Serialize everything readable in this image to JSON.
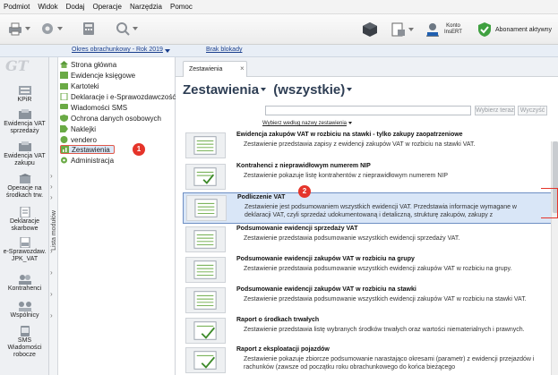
{
  "menubar": [
    "Podmiot",
    "Widok",
    "Dodaj",
    "Operacje",
    "Narzędzia",
    "Pomoc"
  ],
  "toolbar": {
    "buttons": [
      "printer-icon",
      "settings-icon",
      "calculator-icon",
      "search-icon"
    ],
    "right": [
      "cube-icon",
      "document-icon"
    ],
    "konto_label": "Konto",
    "konto_sub": "InsERT",
    "abonament_label": "Abonament aktywny"
  },
  "subbar": {
    "okres": "Okres obrachunkowy - Rok 2019",
    "brak": "Brak blokady"
  },
  "rail": {
    "logo": "GT",
    "items": [
      {
        "label": "KPiR",
        "icon": "kpir-icon"
      },
      {
        "label": "Ewidencja VAT sprzedaży",
        "icon": "vat-sales-icon"
      },
      {
        "label": "Ewidencja VAT zakupu",
        "icon": "vat-purchase-icon"
      },
      {
        "label": "Operacje na środkach trw.",
        "icon": "fixed-assets-icon"
      },
      {
        "label": "Deklaracje skarbowe",
        "icon": "tax-declarations-icon"
      },
      {
        "label": "e-Sprawozdaw. JPK_VAT",
        "icon": "jpk-icon"
      },
      {
        "label": "Kontrahenci",
        "icon": "contractors-icon"
      },
      {
        "label": "Wspólnicy",
        "icon": "partners-icon"
      },
      {
        "label": "SMS Wiadomości robocze",
        "icon": "sms-icon"
      }
    ],
    "vertical_label": "Lista modułów"
  },
  "tree": [
    "Strona główna",
    "Ewidencje księgowe",
    "Kartoteki",
    "Deklaracje i e-Sprawozdawczość",
    "Wiadomości SMS",
    "Ochrona danych osobowych",
    "Naklejki",
    "vendero",
    "Zestawienia",
    "Administracja"
  ],
  "badges": {
    "one": "1",
    "two": "2"
  },
  "tab": {
    "label": "Zestawienia",
    "close": "×"
  },
  "main": {
    "title": "Zestawienia",
    "filter": "(wszystkie)",
    "search_placeholder": "",
    "btn_search": "Wybierz teraz",
    "btn_clear": "Wyczyść",
    "sortby": "Wybierz według nazwy zestawienia"
  },
  "reports": [
    {
      "title": "Ewidencja zakupów VAT w rozbiciu na stawki - tylko zakupy zaopatrzeniowe",
      "desc": "Zestawienie przedstawia zapisy z ewidencji zakupów VAT w rozbiciu na stawki VAT."
    },
    {
      "title": "Kontrahenci z nieprawidłowym numerem NIP",
      "desc": "Zestawienie pokazuje listę kontrahentów z nieprawidłowym numerem NIP"
    },
    {
      "title": "Podliczenie VAT",
      "desc": "Zestawienie jest podsumowaniem wszystkich ewidencji VAT. Przedstawia informacje wymagane w deklaracji VAT, czyli sprzedaż udokumentowaną i detaliczną, strukturę zakupów, zakupy z"
    },
    {
      "title": "Podsumowanie ewidencji sprzedaży VAT",
      "desc": "Zestawienie przedstawia podsumowanie wszystkich ewidencji sprzedaży VAT."
    },
    {
      "title": "Podsumowanie ewidencji zakupów VAT w rozbiciu na grupy",
      "desc": "Zestawienie przedstawia podsumowanie wszystkich ewidencji zakupów VAT w rozbiciu na grupy."
    },
    {
      "title": "Podsumowanie ewidencji zakupów VAT w rozbiciu na stawki",
      "desc": "Zestawienie przedstawia podsumowanie wszystkich ewidencji zakupów VAT w rozbiciu na stawki VAT."
    },
    {
      "title": "Raport o środkach trwałych",
      "desc": "Zestawienie przedstawia listę wybranych środków trwałych oraz wartości niematerialnych i prawnych."
    },
    {
      "title": "Raport z eksploatacji pojazdów",
      "desc": "Zestawienie pokazuje zbiorcze podsumowanie narastająco okresami (parametr) z ewidencji przejazdów i rachunków (zawsze od początku roku obrachunkowego do końca bieżącego"
    }
  ]
}
